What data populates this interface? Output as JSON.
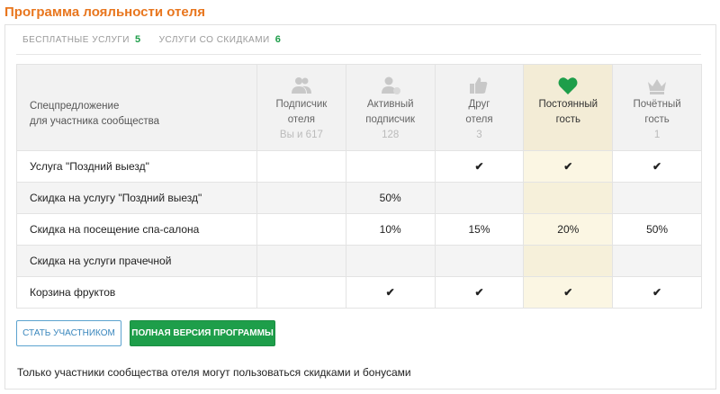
{
  "title": "Программа лояльности отеля",
  "stats": [
    {
      "label": "БЕСПЛАТНЫЕ УСЛУГИ",
      "value": "5"
    },
    {
      "label": "УСЛУГИ СО СКИДКАМИ",
      "value": "6"
    }
  ],
  "header_label_line1": "Спецпредложение",
  "header_label_line2": "для участника сообщества",
  "levels": [
    {
      "line1": "Подписчик",
      "line2": "отеля",
      "sub": "Вы и 617",
      "icon": "users-icon"
    },
    {
      "line1": "Активный",
      "line2": "подписчик",
      "sub": "128",
      "icon": "user-plus-icon"
    },
    {
      "line1": "Друг",
      "line2": "отеля",
      "sub": "3",
      "icon": "thumbs-up-icon"
    },
    {
      "line1": "Постоянный",
      "line2": "гость",
      "sub": "",
      "icon": "heart-icon",
      "highlight": true
    },
    {
      "line1": "Почётный",
      "line2": "гость",
      "sub": "1",
      "icon": "crown-icon"
    }
  ],
  "rows": [
    {
      "label": "Услуга \"Поздний выезд\"",
      "cells": [
        "",
        "",
        "✔",
        "✔",
        "✔"
      ]
    },
    {
      "label": "Скидка на услугу \"Поздний выезд\"",
      "cells": [
        "",
        "50%",
        "",
        "",
        ""
      ]
    },
    {
      "label": "Скидка на посещение спа-салона",
      "cells": [
        "",
        "10%",
        "15%",
        "20%",
        "50%"
      ]
    },
    {
      "label": "Скидка на услуги прачечной",
      "cells": [
        "",
        "",
        "",
        "",
        ""
      ]
    },
    {
      "label": "Корзина фруктов",
      "cells": [
        "",
        "✔",
        "✔",
        "✔",
        "✔"
      ]
    }
  ],
  "buttons": {
    "join": "СТАТЬ УЧАСТНИКОМ",
    "full": "ПОЛНАЯ ВЕРСИЯ ПРОГРАММЫ"
  },
  "note": "Только участники сообщества отеля могут пользоваться скидками и бонусами",
  "colors": {
    "accent": "#e8761e",
    "green": "#1e9e4a",
    "highlight": "#f3ecd6"
  }
}
